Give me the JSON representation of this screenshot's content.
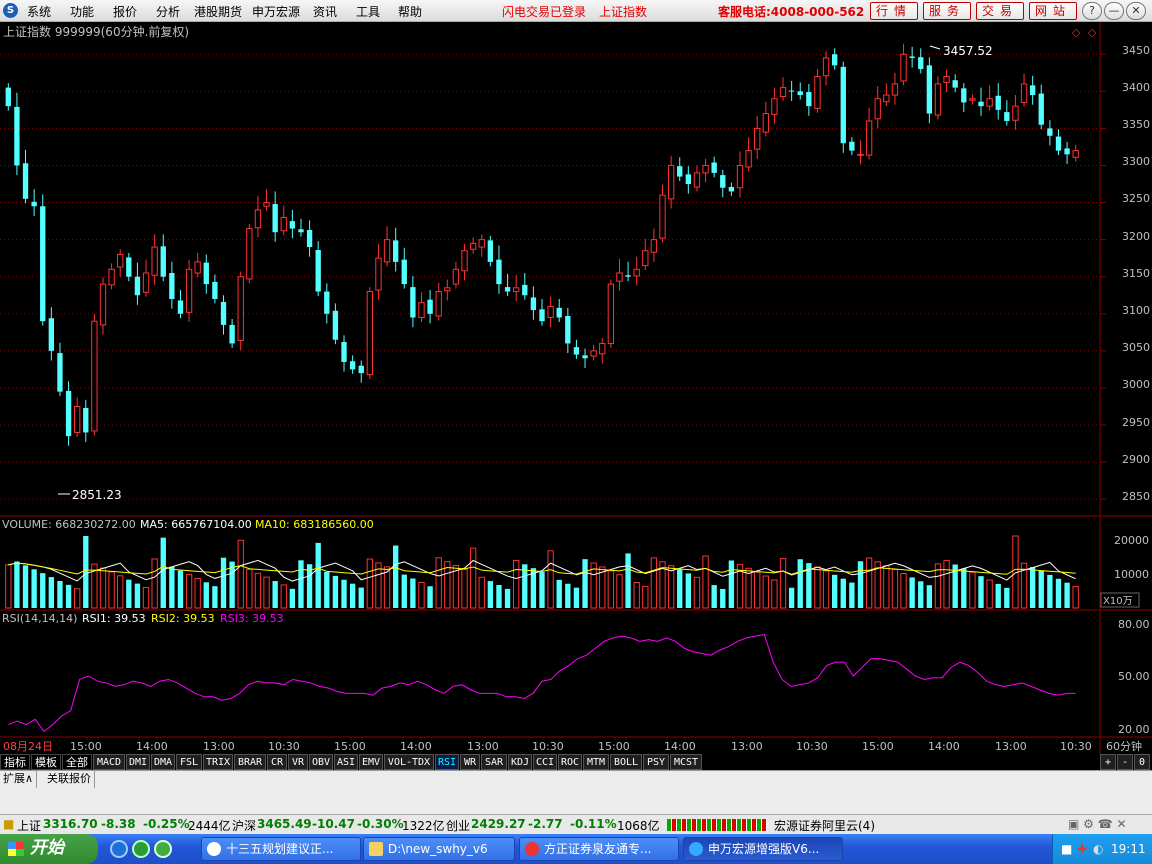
{
  "menu": {
    "items": [
      "系统",
      "功能",
      "报价",
      "分析",
      "港股期货",
      "申万宏源",
      "资讯",
      "工具",
      "帮助"
    ],
    "status": "闪电交易已登录",
    "index": "上证指数",
    "phone": "客服电话:4008-000-562",
    "buttons": [
      "行情",
      "服务",
      "交易",
      "网站"
    ],
    "window_buttons": [
      "?",
      "—",
      "▭",
      "✕"
    ]
  },
  "chart": {
    "header": "上证指数 999999(60分钟.前复权)",
    "high_label": "3457.52",
    "low_label": "2851.23",
    "price_axis": [
      "3450",
      "3400",
      "3350",
      "3300",
      "3250",
      "3200",
      "3150",
      "3100",
      "3050",
      "3000",
      "2950",
      "2900",
      "2850"
    ],
    "volume_header": {
      "volume": "VOLUME: 668230272.00",
      "ma5": "MA5: 665767104.00",
      "ma10": "MA10: 683186560.00"
    },
    "volume_axis": [
      "20000",
      "10000"
    ],
    "volume_unit": "X10万",
    "rsi_header": {
      "label": "RSI(14,14,14)",
      "rsi1": "RSI1: 39.53",
      "rsi2": "RSI2: 39.53",
      "rsi3": "RSI3: 39.53"
    },
    "rsi_axis": [
      "80.00",
      "50.00",
      "20.00"
    ],
    "time_labels": [
      "08月24日",
      "15:00",
      "14:00",
      "13:00",
      "10:30",
      "15:00",
      "14:00",
      "13:00",
      "10:30",
      "15:00",
      "14:00",
      "13:00",
      "10:30",
      "15:00",
      "14:00",
      "13:00",
      "10:30"
    ],
    "period": "60分钟",
    "colors": {
      "up": "#ff3232",
      "down": "#54ffff",
      "ma5": "#ffffff",
      "ma10": "#ffff00",
      "rsi": "#ff00ff",
      "grid": "#8b0000",
      "axis_text": "#c0c0c0"
    }
  },
  "chart_data": {
    "type": "candlestick",
    "title": "上证指数 999999(60分钟.前复权)",
    "ylim": [
      2830,
      3480
    ],
    "high": 3457.52,
    "low": 2851.23,
    "close_series": [
      3380,
      3300,
      3255,
      3245,
      3090,
      3050,
      2995,
      2935,
      2975,
      2940,
      3090,
      3140,
      3160,
      3180,
      3150,
      3125,
      3155,
      3190,
      3150,
      3120,
      3100,
      3160,
      3170,
      3140,
      3120,
      3085,
      3060,
      3150,
      3215,
      3240,
      3250,
      3210,
      3230,
      3215,
      3210,
      3190,
      3130,
      3100,
      3065,
      3035,
      3025,
      3020,
      3130,
      3175,
      3200,
      3170,
      3140,
      3095,
      3115,
      3100,
      3130,
      3135,
      3160,
      3185,
      3195,
      3200,
      3170,
      3140,
      3130,
      3135,
      3125,
      3105,
      3090,
      3110,
      3095,
      3060,
      3045,
      3040,
      3050,
      3060,
      3140,
      3155,
      3150,
      3160,
      3185,
      3200,
      3260,
      3300,
      3285,
      3275,
      3290,
      3300,
      3290,
      3270,
      3265,
      3300,
      3320,
      3350,
      3370,
      3390,
      3405,
      3400,
      3395,
      3380,
      3420,
      3445,
      3435,
      3330,
      3320,
      3315,
      3360,
      3390,
      3395,
      3410,
      3450,
      3445,
      3430,
      3370,
      3410,
      3420,
      3405,
      3385,
      3390,
      3380,
      3390,
      3375,
      3360,
      3380,
      3410,
      3395,
      3355,
      3340,
      3320,
      3315,
      3320
    ],
    "volume_axis_max": 20000,
    "rsi_series": [
      22,
      24,
      22,
      25,
      18,
      22,
      27,
      30,
      48,
      50,
      47,
      46,
      44,
      45,
      47,
      46,
      44,
      47,
      48,
      46,
      43,
      40,
      38,
      38,
      36,
      37,
      40,
      45,
      47,
      46,
      46,
      45,
      48,
      47,
      46,
      44,
      43,
      41,
      40,
      40,
      40,
      39,
      43,
      44,
      46,
      45,
      47,
      45,
      42,
      40,
      44,
      45,
      42,
      40,
      40,
      40,
      38,
      38,
      37,
      40,
      47,
      48,
      53,
      56,
      60,
      62,
      66,
      70,
      72,
      73,
      72,
      70,
      71,
      70,
      72,
      70,
      66,
      64,
      63,
      62,
      65,
      67,
      70,
      72,
      73,
      74,
      58,
      48,
      44,
      45,
      46,
      49,
      56,
      58,
      58,
      50,
      55,
      60,
      60,
      59,
      58,
      54,
      50,
      48,
      49,
      49,
      55,
      58,
      56,
      52,
      47,
      45,
      44,
      45,
      46,
      44,
      42,
      40,
      39,
      40,
      40
    ]
  },
  "tabs": [
    "指标",
    "模板",
    "全部",
    "MACD",
    "DMI",
    "DMA",
    "FSL",
    "TRIX",
    "BRAR",
    "CR",
    "VR",
    "OBV",
    "ASI",
    "EMV",
    "VOL-TDX",
    "RSI",
    "WR",
    "SAR",
    "KDJ",
    "CCI",
    "ROC",
    "MTM",
    "BOLL",
    "PSY",
    "MCST"
  ],
  "right_tabs": [
    "+",
    "-",
    "0"
  ],
  "subtabs": [
    "扩展∧",
    "关联报价"
  ],
  "status": {
    "sh_label": "上证",
    "sh_val": "3316.70",
    "sh_chg": "-8.38",
    "sh_pct": "-0.25%",
    "sh_amt": "2444亿",
    "hs_label": "沪深",
    "hs_val": "3465.49",
    "hs_chg": "-10.47",
    "hs_pct": "-0.30%",
    "hs_amt": "1322亿",
    "cy_label": "创业",
    "cy_val": "2429.27",
    "cy_chg": "-2.77",
    "cy_pct": "-0.11%",
    "cy_amt": "1068亿",
    "broker": "宏源证券阿里云(4)"
  },
  "taskbar": {
    "start": "开始",
    "tasks": [
      "十三五规划建议正...",
      "D:\\new_swhy_v6",
      "方正证券泉友通专...",
      "申万宏源增强版V6..."
    ],
    "clock": "19:11"
  }
}
